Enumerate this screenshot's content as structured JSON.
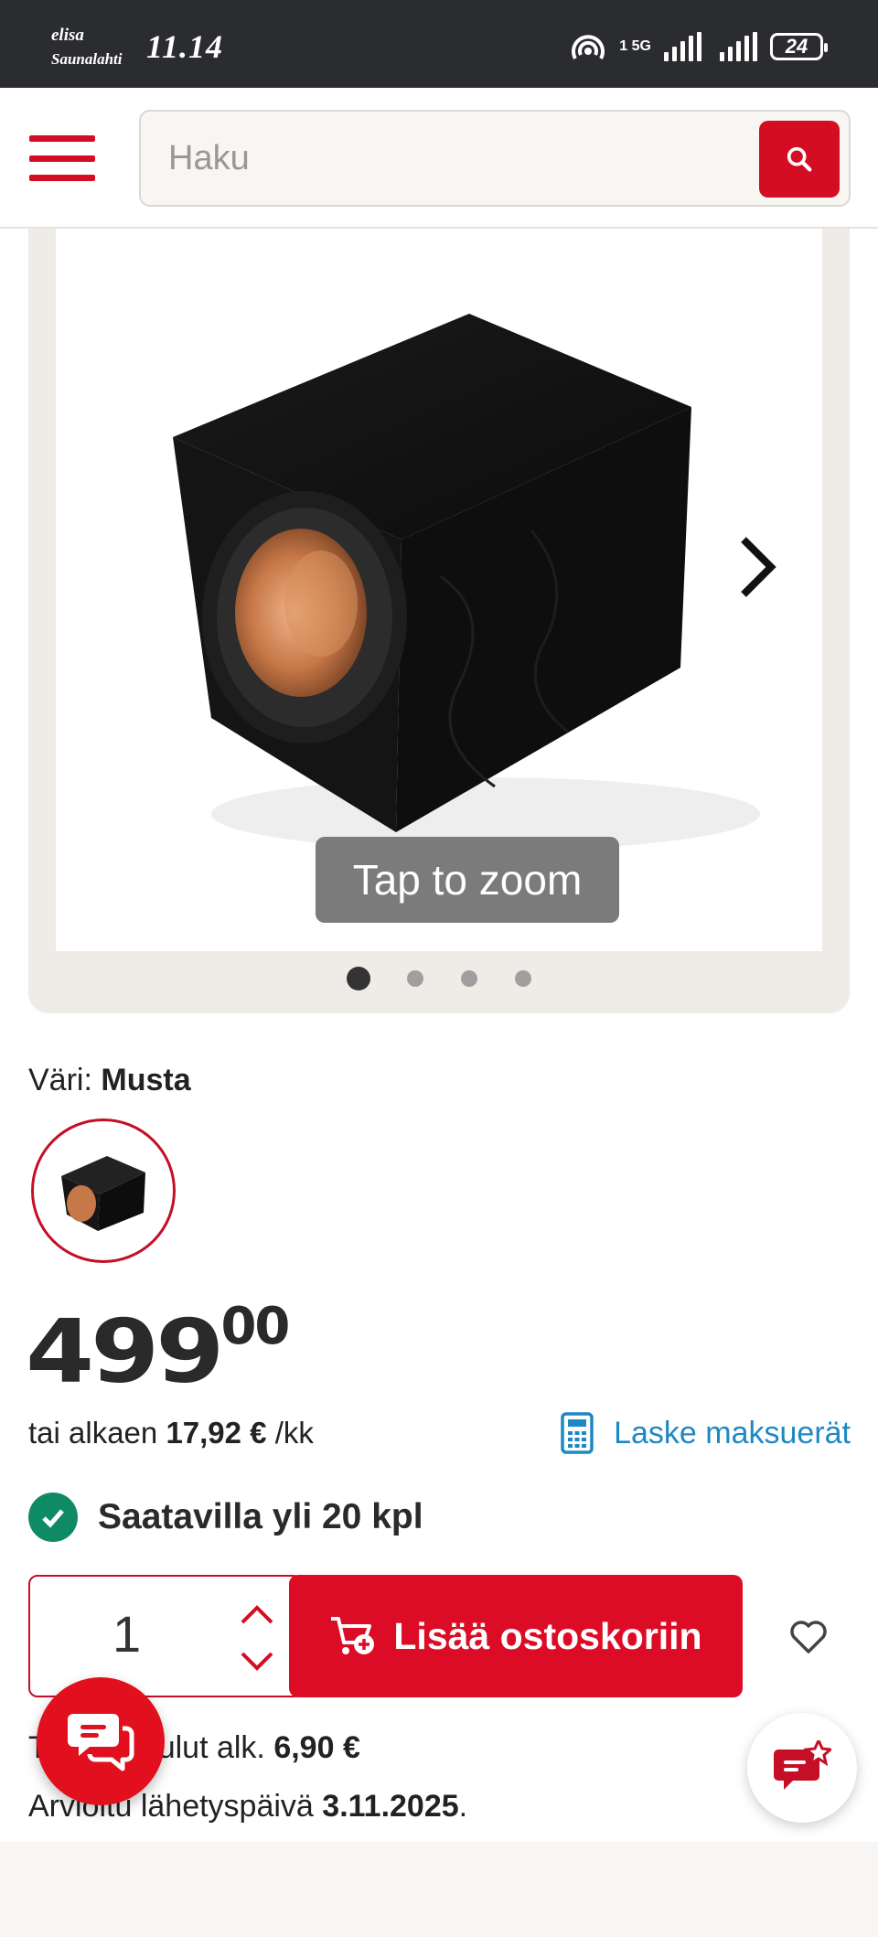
{
  "status_bar": {
    "carrier_line1": "elisa",
    "carrier_line2": "Saunalahti",
    "time": "11.14",
    "network_label": "5G",
    "sim_label": "1",
    "battery": "24"
  },
  "header": {
    "search_placeholder": "Haku",
    "brand_color": "#d40c24"
  },
  "gallery": {
    "zoom_hint": "Tap to zoom",
    "slide_count": 4,
    "active_slide": 1
  },
  "product": {
    "color_label": "Väri:",
    "color_value": "Musta",
    "price_main": "499",
    "price_cents": "00",
    "installment_prefix": "tai alkaen",
    "installment_amount": "17,92 €",
    "installment_suffix": "/kk",
    "calc_link": "Laske maksuerät",
    "stock_text": "Saatavilla yli 20 kpl",
    "quantity": "1",
    "add_to_cart": "Lisää ostoskoriin",
    "shipping_prefix": "Toimituskulut alk.",
    "shipping_amount": "6,90 €",
    "ship_date_prefix": "Arvioitu lähetyspäivä",
    "ship_date_value": "3.11.2025",
    "ship_date_suffix": "."
  },
  "icons": {
    "menu": "hamburger-menu-icon",
    "search": "search-icon",
    "next": "chevron-right-icon",
    "calculator": "calculator-icon",
    "stock": "checkmark-circle-icon",
    "cart": "cart-add-icon",
    "wishlist": "heart-icon",
    "chat": "chat-bubbles-icon",
    "feedback": "feedback-star-icon"
  }
}
